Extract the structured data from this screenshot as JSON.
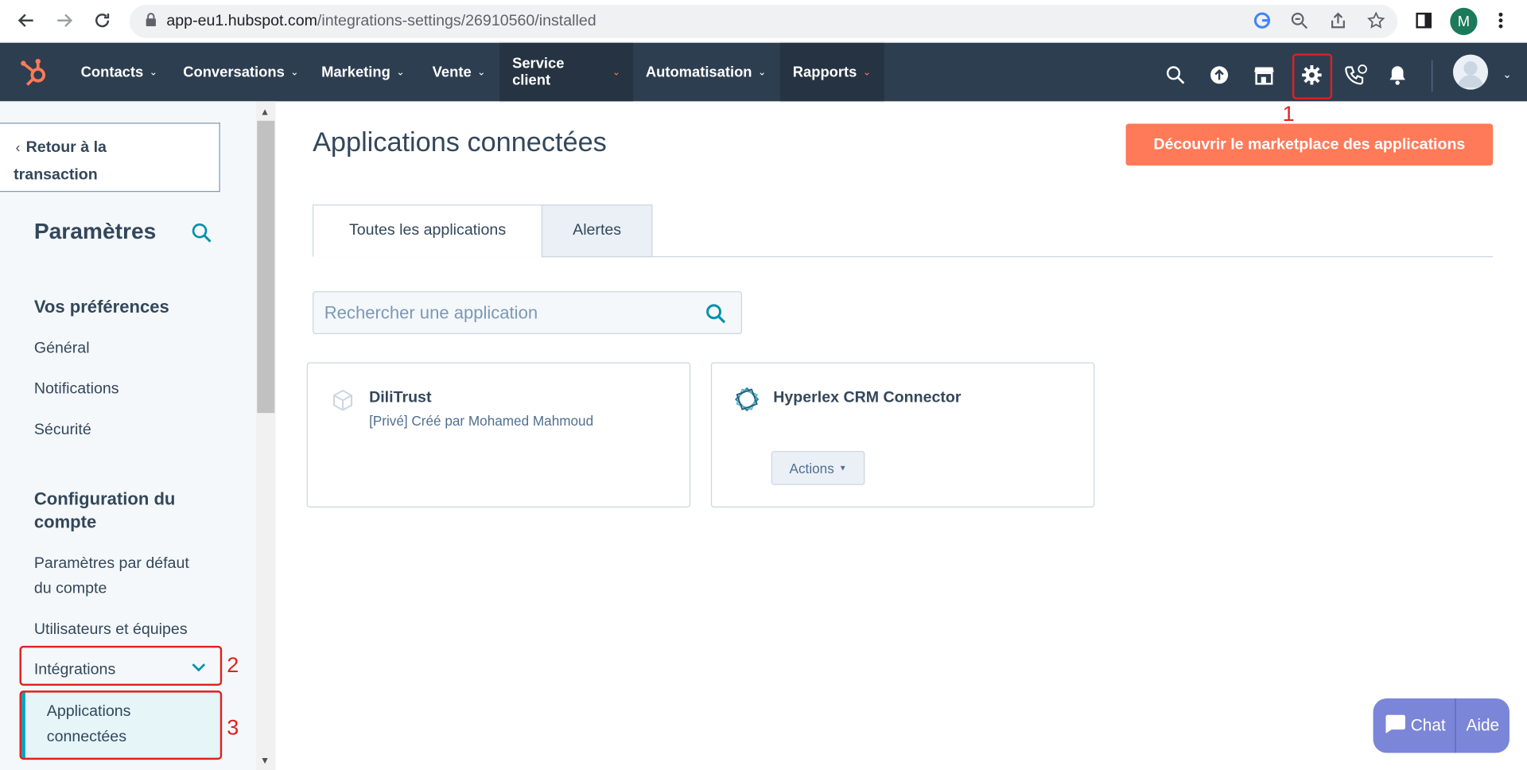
{
  "browser": {
    "url_domain": "app-eu1.hubspot.com",
    "url_path": "/integrations-settings/26910560/installed",
    "profile_initial": "M"
  },
  "topnav": {
    "items": [
      {
        "label": "Contacts"
      },
      {
        "label": "Conversations"
      },
      {
        "label": "Marketing"
      },
      {
        "label": "Vente"
      },
      {
        "label": "Service client"
      },
      {
        "label": "Automatisation"
      },
      {
        "label": "Rapports"
      }
    ]
  },
  "annotations": {
    "one": "1",
    "two": "2",
    "three": "3"
  },
  "sidebar": {
    "back_label_line1": "Retour à la",
    "back_label_line2": "transaction",
    "title": "Paramètres",
    "section1": "Vos préférences",
    "section1_items": [
      "Général",
      "Notifications",
      "Sécurité"
    ],
    "section2_line1": "Configuration du",
    "section2_line2": "compte",
    "defaults_line1": "Paramètres par défaut",
    "defaults_line2": "du compte",
    "users_teams": "Utilisateurs et équipes",
    "integrations": "Intégrations",
    "connected_line1": "Applications",
    "connected_line2": "connectées"
  },
  "main": {
    "title": "Applications connectées",
    "cta": "Découvrir le marketplace des applications",
    "tabs": [
      "Toutes les applications",
      "Alertes"
    ],
    "search_placeholder": "Rechercher une application",
    "apps": [
      {
        "name": "DiliTrust",
        "meta": "[Privé] Créé par Mohamed Mahmoud"
      },
      {
        "name": "Hyperlex CRM Connector",
        "actions_label": "Actions"
      }
    ]
  },
  "chat": {
    "chat_label": "Chat",
    "help_label": "Aide"
  }
}
